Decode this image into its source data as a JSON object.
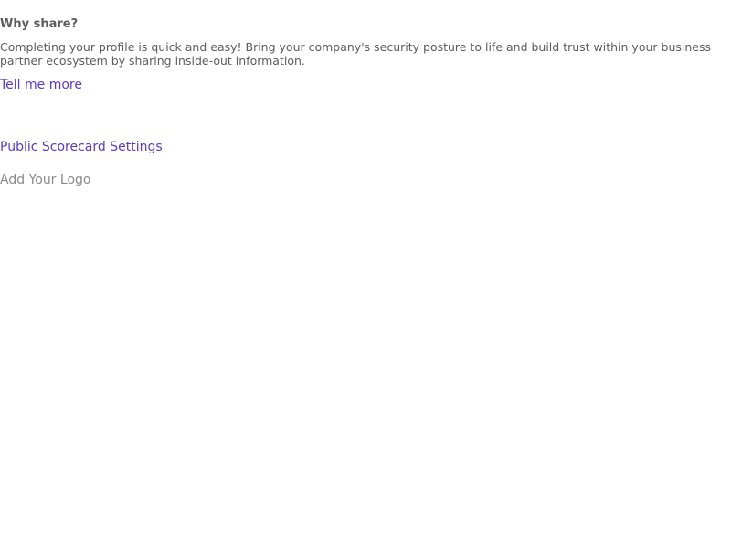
{
  "why_share": {
    "heading": "Why share?",
    "body": "Completing your profile is quick and easy! Bring your company's security posture to life and build trust within your business partner ecosystem by sharing inside-out information.",
    "link_label": "Tell me more"
  },
  "settings": {
    "public_scorecard_link": "Public Scorecard Settings",
    "add_logo_label": "Add Your Logo"
  },
  "colors": {
    "link": "#5a38d4",
    "text": "#5d5d5d",
    "muted": "#8a8a8a"
  }
}
